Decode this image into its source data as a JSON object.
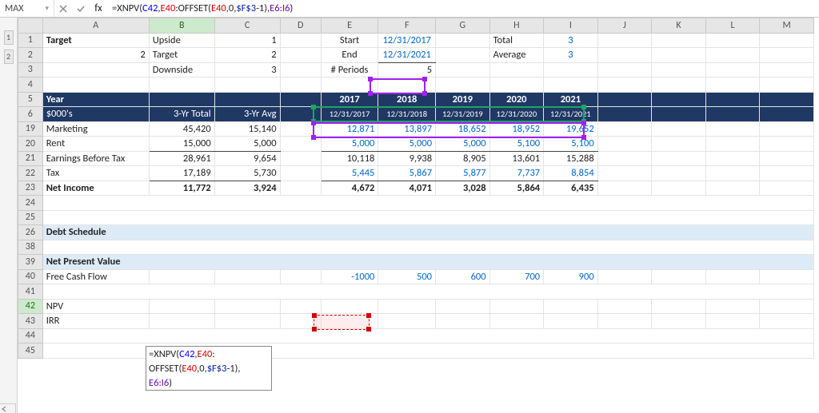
{
  "formula_bar": {
    "namebox": "MAX",
    "formula_raw": "=XNPV(C42,E40:OFFSET(E40,0,$F$3-1),E6:I6)"
  },
  "columns": [
    "A",
    "B",
    "C",
    "D",
    "E",
    "F",
    "G",
    "H",
    "I",
    "J",
    "K",
    "L",
    "M"
  ],
  "row_labels": [
    "1",
    "2",
    "3",
    "4",
    "5",
    "6",
    "19",
    "20",
    "21",
    "22",
    "23",
    "24",
    "25",
    "26",
    "38",
    "39",
    "40",
    "41",
    "42",
    "43",
    "44",
    "45"
  ],
  "cells": {
    "r1": {
      "A": "Target",
      "B": "Upside",
      "C": "1",
      "E": "Start",
      "F": "12/31/2017",
      "H": "Total",
      "I": "3"
    },
    "r2": {
      "A": "2",
      "B": "Target",
      "C": "2",
      "E": "End",
      "F": "12/31/2021",
      "H": "Average",
      "I": "3"
    },
    "r3": {
      "B": "Downside",
      "C": "3",
      "E": "# Periods",
      "F": "5"
    },
    "r5": {
      "A": "Year",
      "E": "2017",
      "F": "2018",
      "G": "2019",
      "H": "2020",
      "I": "2021"
    },
    "r6": {
      "A": "$000's",
      "B": "3-Yr Total",
      "C": "3-Yr Avg",
      "E": "12/31/2017",
      "F": "12/31/2018",
      "G": "12/31/2019",
      "H": "12/31/2020",
      "I": "12/31/2021"
    },
    "r19": {
      "A": "Marketing",
      "B": "45,420",
      "C": "15,140",
      "E": "12,871",
      "F": "13,897",
      "G": "18,652",
      "H": "18,952",
      "I": "19,652"
    },
    "r20": {
      "A": "Rent",
      "B": "15,000",
      "C": "5,000",
      "E": "5,000",
      "F": "5,000",
      "G": "5,000",
      "H": "5,100",
      "I": "5,100"
    },
    "r21": {
      "A": "Earnings Before Tax",
      "B": "28,961",
      "C": "9,654",
      "E": "10,118",
      "F": "9,938",
      "G": "8,905",
      "H": "13,601",
      "I": "15,288"
    },
    "r22": {
      "A": "Tax",
      "B": "17,189",
      "C": "5,730",
      "E": "5,445",
      "F": "5,867",
      "G": "5,877",
      "H": "7,737",
      "I": "8,854"
    },
    "r23": {
      "A": "Net Income",
      "B": "11,772",
      "C": "3,924",
      "E": "4,672",
      "F": "4,071",
      "G": "3,028",
      "H": "5,864",
      "I": "6,435"
    },
    "r26": {
      "A": "Debt Schedule"
    },
    "r39": {
      "A": "Net Present Value"
    },
    "r40": {
      "A": "Free Cash Flow",
      "E": "-1000",
      "F": "500",
      "G": "600",
      "H": "700",
      "I": "900"
    },
    "r42": {
      "A": "NPV"
    },
    "r43": {
      "A": "IRR"
    }
  },
  "editbox": {
    "line1_pre": "=XNPV(",
    "line1_c42": "C42",
    "line1_comma": ",",
    "line1_e40": "E40",
    "line1_colon": ":",
    "line2_off": "OFFSET(",
    "line2_e40": "E40",
    "line2_mid": ",0,",
    "line2_f3": "$F$3",
    "line2_tail": "-1),",
    "line3_range": "E6:I6",
    "line3_close": ")"
  },
  "chart_data": null
}
